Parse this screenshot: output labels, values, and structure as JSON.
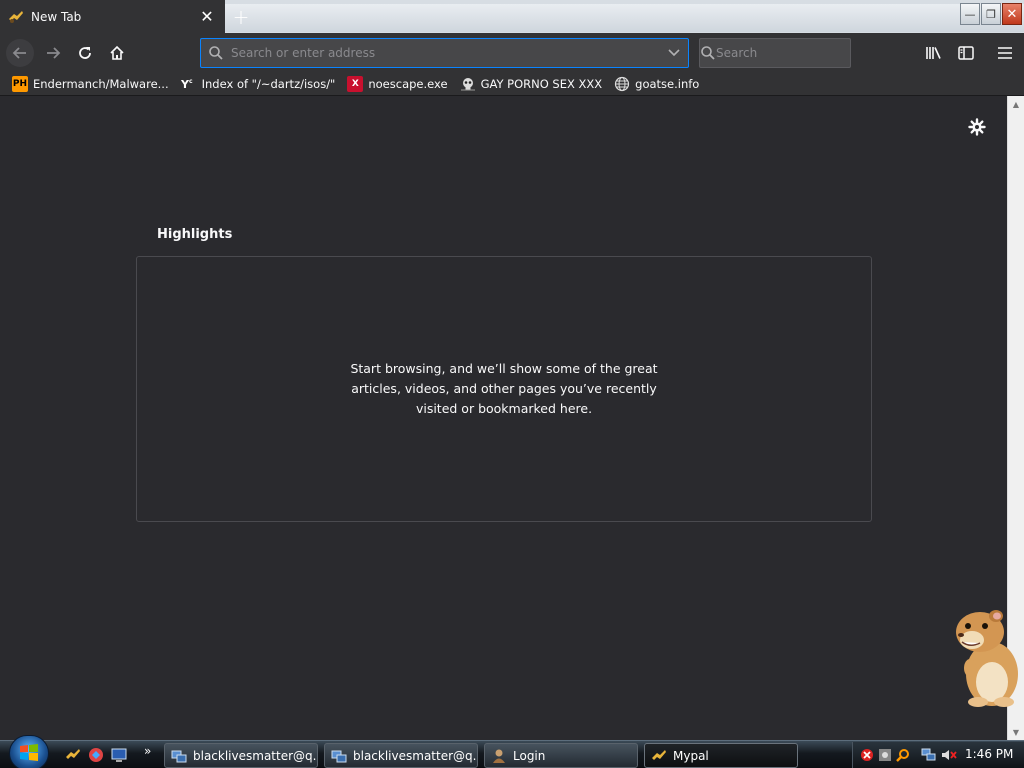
{
  "tab": {
    "title": "New Tab",
    "close_label": "✕"
  },
  "newtab": {
    "label": "+"
  },
  "window_controls": {
    "minimize": "—",
    "restore": "❐",
    "close": "✕"
  },
  "urlbar": {
    "placeholder": "Search or enter address"
  },
  "searchbar": {
    "placeholder": "Search"
  },
  "bookmarks": [
    {
      "label": "Endermanch/Malware...",
      "icon": "pornhub-favicon",
      "icon_text": "PH"
    },
    {
      "label": "Index of \"/~dartz/isos/\"",
      "icon": "ycombinator-favicon",
      "icon_text": "Y"
    },
    {
      "label": "noescape.exe",
      "icon": "x-favicon",
      "icon_text": "X"
    },
    {
      "label": "GAY PORNO SEX XXX",
      "icon": "skull-favicon"
    },
    {
      "label": "goatse.info",
      "icon": "globe-icon"
    }
  ],
  "content": {
    "highlights_title": "Highlights",
    "empty_message": "Start browsing, and we’ll show some of the great articles, videos, and other pages you’ve recently visited or bookmarked here."
  },
  "taskbar": {
    "items": [
      {
        "label": "blacklivesmatter@q...",
        "icon": "network-icon"
      },
      {
        "label": "blacklivesmatter@q...",
        "icon": "network-icon"
      },
      {
        "label": "Login",
        "icon": "user-icon"
      },
      {
        "label": "Mypal",
        "icon": "mypal-icon"
      }
    ],
    "clock": "1:46 PM"
  },
  "colors": {
    "accent": "#0a84ff",
    "toolbar": "#323234",
    "content_bg": "#2a2a2e"
  }
}
